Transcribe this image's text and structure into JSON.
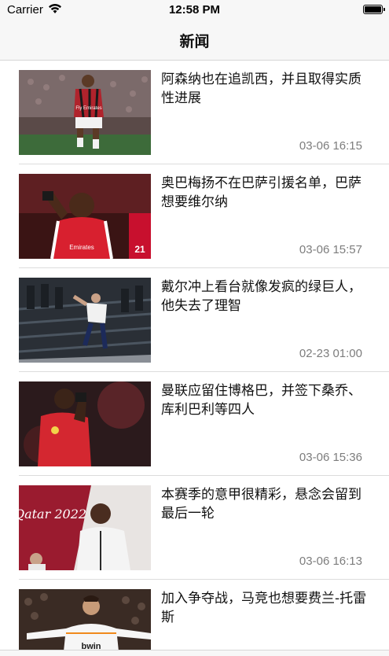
{
  "status_bar": {
    "carrier": "Carrier",
    "time": "12:58 PM",
    "wifi_icon": "wifi-icon",
    "battery_icon": "battery-icon"
  },
  "nav": {
    "title": "新闻"
  },
  "news": [
    {
      "headline": "阿森纳也在追凯西，并且取得实质性进展",
      "date": "03-06 16:15",
      "image": "player-photo",
      "thumb_text": "Fly Emirates"
    },
    {
      "headline": "奥巴梅扬不在巴萨引援名单，巴萨想要维尔纳",
      "date": "03-06 15:57",
      "image": "player-photo",
      "thumb_text": "Emirates"
    },
    {
      "headline": "戴尔冲上看台就像发疯的绿巨人，他失去了理智",
      "date": "02-23 01:00",
      "image": "stadium-photo",
      "thumb_text": ""
    },
    {
      "headline": "曼联应留住博格巴，并签下桑乔、库利巴利等四人",
      "date": "03-06 15:36",
      "image": "player-photo",
      "thumb_text": ""
    },
    {
      "headline": "本赛季的意甲很精彩，悬念会留到最后一轮",
      "date": "03-06 16:13",
      "image": "pundit-photo",
      "thumb_text": "Qatar 2022"
    },
    {
      "headline": "加入争夺战，马竞也想要费兰-托雷斯",
      "date": "",
      "image": "player-photo",
      "thumb_text": "bwin"
    }
  ]
}
